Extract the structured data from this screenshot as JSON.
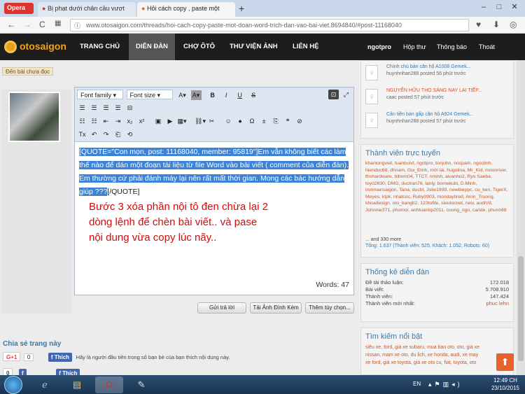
{
  "browser": {
    "app_label": "Opera",
    "tabs": [
      {
        "label": "Bị phạt dưới chân cầu vượt"
      },
      {
        "label": "Hỏi cách copy , paste một"
      }
    ],
    "new_tab": "+",
    "url": "www.otosaigon.com/threads/hoi-cach-copy-paste-mot-doan-word-trich-dan-vao-bai-viet.8694840/#post-11168040"
  },
  "site": {
    "logo": "otosaigon",
    "nav": [
      "TRANG CHỦ",
      "DIỄN ĐÀN",
      "CHỢ ÔTÔ",
      "THƯ VIỆN ẢNH",
      "LIÊN HỆ"
    ],
    "active_nav": "DIỄN ĐÀN",
    "user": "ngotpro",
    "user_links": [
      "Hộp thư",
      "Thông báo",
      "Thoát"
    ]
  },
  "main": {
    "new_post_label": "Đến bài chưa đọc",
    "editor": {
      "font_family": "Font family",
      "font_size": "Font size",
      "quote_selected": "[QUOTE=\"Con mọn, post: 11168040, member: 95819\"]Em  vẫn không biết các làm thế nào để dán một đoạn tài liệu từ file Word vào bài viết ( comment của diễn đàn). Em thường cứ phải đánh máy lại nên rất mất thời gian. Mong các bác hướng dẫn giúp ???",
      "quote_end": "[/QUOTE]",
      "annotation": "Bước 3  xóa phần nội tô đen chừa lại 2 dòng lệnh để chèn bài viết.. và pase nội dung vừa copy lúc nãy..",
      "words_label": "Words: 47"
    },
    "buttons": [
      "Gửi trả lời",
      "Tải Ảnh Đính Kèm",
      "Thêm tùy chọn..."
    ],
    "share": {
      "title": "Chia sẻ trang này",
      "gplus": "G+1",
      "gplus_count": "0",
      "fb_like": "Thích",
      "fb_text": "Hãy là người đầu tiên trong số bạn bè của bạn thích nội dung này."
    }
  },
  "sidebar": {
    "recent_posts": [
      {
        "title": "Chính chủ bán căn hộ A1008 Gemek...",
        "meta": "huynhnhan288 posted 56 phút trước"
      },
      {
        "title": "NGUYỄN HỮU THO SÁNG NAY LẠI TIẾP...",
        "meta": "caac posted 57 phút trước"
      },
      {
        "title": "Cần tiền bán gấp căn hộ A924 Gemek...",
        "meta": "huynhnhan288 posted 57 phút trước"
      }
    ],
    "online": {
      "title": "Thành viên trực tuyến",
      "names": "khanlongviet, tuanbuivt, ngotpro, tonjohn, nospam, ngoclinh, hienduc68, dhnam, Gia_Đình, mới lái, hugolina, Mr_Kid, moonriver, thohardware, bibom04, TTCT, nminh, aivanho2, Ryo Saeba, toyo2630, DMG, ductran76, lanly, bomekubi, D.Minh, ironmansaigon, Tana, ducbt, Jolie1999, newbieppc, cu_ken, TigerX, Meyes, ktpk, nhatcoc, Ruby0903, mondaytired, Aron_Truong, khoadesign, oto_bangb2, 123tofite, sieutocnet, neiv, audiV8, Johnnie371, phomoi, anhtuanbp2011, cuong_ngo, caride, phunn68",
      "more": "... and 330 more",
      "total": "Tổng: 1.637 (Thành viên: 525, Khách: 1.052, Robots: 60)"
    },
    "stats": {
      "title": "Thống kê diễn đàn",
      "rows": [
        {
          "label": "Đề tài thảo luận:",
          "value": "172.018"
        },
        {
          "label": "Bài viết:",
          "value": "5.708.910"
        },
        {
          "label": "Thành viên:",
          "value": "147.424"
        },
        {
          "label": "Thành viên mới nhất:",
          "value": "phuc lehn"
        }
      ]
    },
    "search": {
      "title": "Tìm kiếm nổi bật",
      "lines": [
        "siêu xe, ford, giá xe subaru, mua ban oto, oto, giá xe",
        "nissan, mam xe oto, du lich, xe honda, audi, xe may",
        "xe ford, giá xe toyota, giá xe oto cu, fiat, toyota, oto"
      ]
    }
  },
  "taskbar": {
    "lang": "EN",
    "time": "12:49 CH",
    "date": "23/10/2015"
  }
}
